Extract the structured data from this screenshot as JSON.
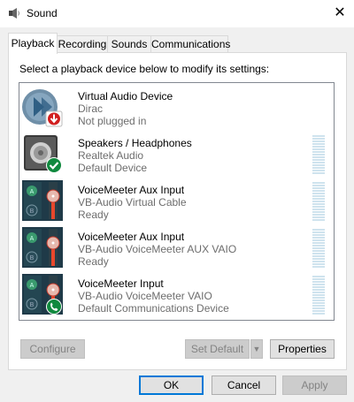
{
  "window": {
    "title": "Sound",
    "close_glyph": "✕"
  },
  "tabs": [
    {
      "label": "Playback",
      "active": true
    },
    {
      "label": "Recording",
      "active": false
    },
    {
      "label": "Sounds",
      "active": false
    },
    {
      "label": "Communications",
      "active": false
    }
  ],
  "prompt": "Select a playback device below to modify its settings:",
  "devices": [
    {
      "name": "Virtual Audio Device",
      "driver": "Dirac",
      "status": "Not plugged in",
      "icon": "speaker-icon",
      "badge": "red-down-arrow-badge",
      "has_meter": false
    },
    {
      "name": "Speakers / Headphones",
      "driver": "Realtek Audio",
      "status": "Default Device",
      "icon": "speaker-icon",
      "badge": "green-check-badge",
      "has_meter": true
    },
    {
      "name": "VoiceMeeter Aux Input",
      "driver": "VB-Audio Virtual Cable",
      "status": "Ready",
      "icon": "voicemeeter-icon",
      "badge": "",
      "has_meter": true
    },
    {
      "name": "VoiceMeeter Aux Input",
      "driver": "VB-Audio VoiceMeeter AUX VAIO",
      "status": "Ready",
      "icon": "voicemeeter-icon",
      "badge": "",
      "has_meter": true
    },
    {
      "name": "VoiceMeeter Input",
      "driver": "VB-Audio VoiceMeeter VAIO",
      "status": "Default Communications Device",
      "icon": "voicemeeter-icon",
      "badge": "green-phone-badge",
      "has_meter": true
    }
  ],
  "buttons": {
    "configure": "Configure",
    "set_default": "Set Default",
    "properties": "Properties",
    "ok": "OK",
    "cancel": "Cancel",
    "apply": "Apply"
  },
  "colors": {
    "selected_tab_border": "#d9d9d9",
    "focus_blue": "#0078d7",
    "meter": "#cfe3ee",
    "vm_green": "#2e7d5b",
    "vm_red": "#e8472c"
  }
}
